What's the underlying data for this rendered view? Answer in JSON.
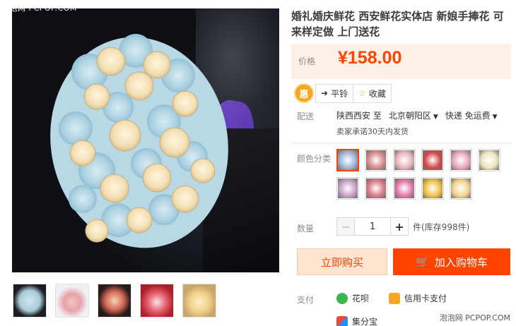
{
  "watermark_top": "泡泡网 PCPOP.COM",
  "watermark_bottom": "泡泡网 PCPOP.COM",
  "product": {
    "title": "婚礼婚庆鲜花 西安鲜花实体店 新娘手捧花 可来样定做 上门送花"
  },
  "price": {
    "label": "价格",
    "value": "¥158.00"
  },
  "share": {
    "badge": "惠",
    "compare_label": "平铃",
    "favorite_label": "收藏"
  },
  "delivery": {
    "label": "配送",
    "from": "陕西西安",
    "to_label": "至",
    "to": "北京朝阳区",
    "shipping": "快递 免运费",
    "promise": "卖家承诺30天内发货"
  },
  "color": {
    "label": "颜色分类",
    "swatches": [
      {
        "name": "swatch-1",
        "color": "#9fb9d6"
      },
      {
        "name": "swatch-2",
        "color": "#d58a8a"
      },
      {
        "name": "swatch-3",
        "color": "#e7b6bf"
      },
      {
        "name": "swatch-4",
        "color": "#d24a4a"
      },
      {
        "name": "swatch-5",
        "color": "#e9a8b6"
      },
      {
        "name": "swatch-6",
        "color": "#eee6c0"
      },
      {
        "name": "swatch-7",
        "color": "#c7a2c8"
      },
      {
        "name": "swatch-8",
        "color": "#d97b88"
      },
      {
        "name": "swatch-9",
        "color": "#e07aa5"
      },
      {
        "name": "swatch-10",
        "color": "#f1c04a"
      },
      {
        "name": "swatch-11",
        "color": "#f3d48e"
      }
    ]
  },
  "quantity": {
    "label": "数量",
    "value": "1",
    "stock": "件(库存998件)"
  },
  "actions": {
    "buy_now": "立即购买",
    "add_to_cart": "加入购物车"
  },
  "payment": {
    "label": "支付",
    "methods": [
      "花呗",
      "信用卡支付",
      "集分宝"
    ]
  },
  "colors": {
    "accent": "#ff4400",
    "price_bg": "#fdf0e6"
  }
}
